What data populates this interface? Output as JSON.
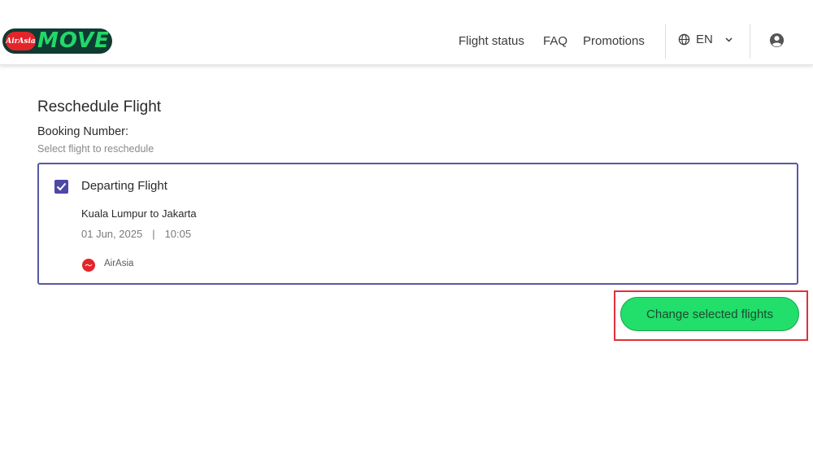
{
  "brand": {
    "badge_text": "AirAsia",
    "logo_text": "MOVE",
    "accent_green": "#22de6a",
    "brand_red": "#e4242b",
    "brand_dark": "#0f3b32"
  },
  "nav": {
    "links": [
      "Flight status",
      "FAQ",
      "Promotions"
    ],
    "language": "EN",
    "icons": {
      "language": "globe-icon",
      "dropdown": "chevron-down-icon",
      "account": "user-icon"
    }
  },
  "page": {
    "title": "Reschedule Flight",
    "booking_label": "Booking Number:",
    "hint": "Select flight to reschedule"
  },
  "flight": {
    "checked": true,
    "title": "Departing Flight",
    "route": "Kuala Lumpur to Jakarta",
    "date": "01 Jun, 2025",
    "separator": "|",
    "time": "10:05",
    "airline": "AirAsia",
    "selected_border_color": "#5a56a6"
  },
  "actions": {
    "change_label": "Change selected flights",
    "highlight_color": "#e0323a"
  }
}
